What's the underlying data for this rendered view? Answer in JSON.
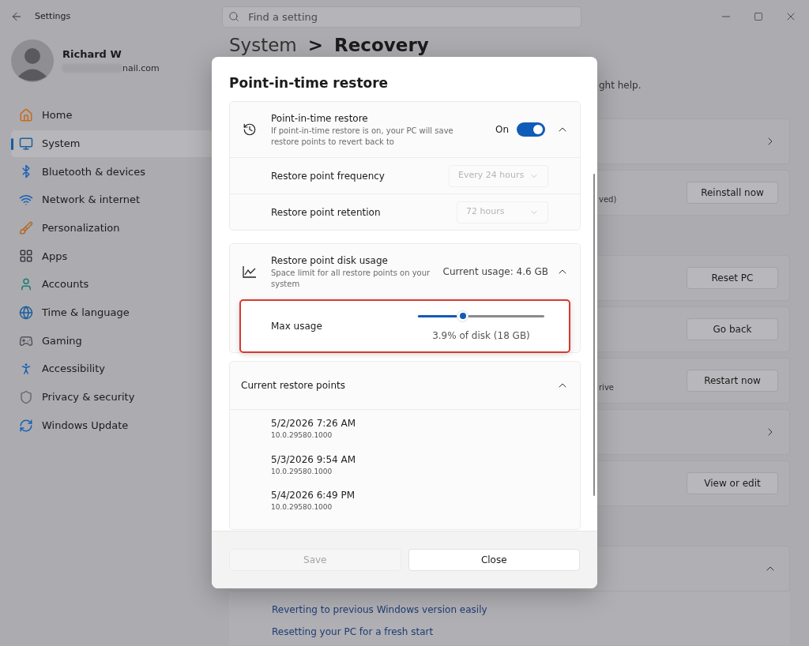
{
  "window": {
    "title": "Settings"
  },
  "search": {
    "placeholder": "Find a setting"
  },
  "user": {
    "name": "Richard W",
    "email_visible": "nail.com"
  },
  "sidebar": {
    "items": [
      {
        "label": "Home",
        "selected": false
      },
      {
        "label": "System",
        "selected": true
      },
      {
        "label": "Bluetooth & devices",
        "selected": false
      },
      {
        "label": "Network & internet",
        "selected": false
      },
      {
        "label": "Personalization",
        "selected": false
      },
      {
        "label": "Apps",
        "selected": false
      },
      {
        "label": "Accounts",
        "selected": false
      },
      {
        "label": "Time & language",
        "selected": false
      },
      {
        "label": "Gaming",
        "selected": false
      },
      {
        "label": "Accessibility",
        "selected": false
      },
      {
        "label": "Privacy & security",
        "selected": false
      },
      {
        "label": "Windows Update",
        "selected": false
      }
    ]
  },
  "page": {
    "breadcrumb": [
      "System",
      ">",
      "Recovery"
    ],
    "subtitle_fragment": "ght help.",
    "groups": [
      {
        "rows": [
          {
            "kind": "chevron"
          },
          {
            "kind": "button",
            "button": "Reinstall now",
            "fragment": "ved)"
          }
        ]
      },
      {
        "rows": [
          {
            "kind": "button",
            "button": "Reset PC"
          },
          {
            "kind": "button",
            "button": "Go back"
          },
          {
            "kind": "button",
            "button": "Restart now",
            "fragment": "rive"
          },
          {
            "kind": "chevron"
          },
          {
            "kind": "button",
            "button": "View or edit"
          }
        ]
      },
      {
        "rows": [
          {
            "kind": "expanded"
          }
        ],
        "links": [
          "Reverting to previous Windows version easily",
          "Resetting your PC for a fresh start"
        ]
      }
    ]
  },
  "dialog": {
    "title": "Point-in-time restore",
    "restore": {
      "title": "Point-in-time restore",
      "description": "If point-in-time restore is on, your PC will save restore points to revert back to",
      "state_label": "On",
      "on": true,
      "expanded": true,
      "settings": [
        {
          "label": "Restore point frequency",
          "value": "Every 24 hours",
          "disabled": true
        },
        {
          "label": "Restore point retention",
          "value": "72 hours",
          "disabled": true
        }
      ]
    },
    "disk": {
      "title": "Restore point disk usage",
      "description": "Space limit for all restore points on your system",
      "usage": "Current usage: 4.6 GB",
      "expanded": true,
      "max_usage": {
        "label": "Max usage",
        "level": 0.35,
        "reading": "3.9% of disk (18 GB)",
        "highlighted": true
      }
    },
    "points": {
      "title": "Current restore points",
      "expanded": true,
      "items": [
        {
          "date": "5/2/2026 7:26 AM",
          "version": "10.0.29580.1000"
        },
        {
          "date": "5/3/2026 9:54 AM",
          "version": "10.0.29580.1000"
        },
        {
          "date": "5/4/2026 6:49 PM",
          "version": "10.0.29580.1000"
        }
      ]
    },
    "buttons": [
      {
        "label": "Save",
        "disabled": true
      },
      {
        "label": "Close",
        "disabled": false
      }
    ]
  }
}
